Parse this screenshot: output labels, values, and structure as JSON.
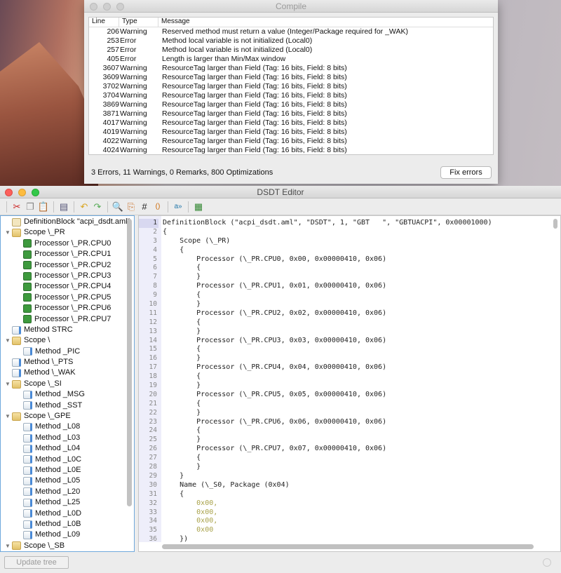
{
  "compile": {
    "title": "Compile",
    "columns": [
      "Line",
      "Type",
      "Message"
    ],
    "rows": [
      [
        "206",
        "Warning",
        "Reserved method must return a value (Integer/Package required for _WAK)"
      ],
      [
        "253",
        "Error",
        "Method local variable is not initialized (Local0)"
      ],
      [
        "257",
        "Error",
        "Method local variable is not initialized (Local0)"
      ],
      [
        "405",
        "Error",
        "Length is larger than Min/Max window"
      ],
      [
        "3607",
        "Warning",
        "ResourceTag larger than Field (Tag: 16 bits, Field: 8 bits)"
      ],
      [
        "3609",
        "Warning",
        "ResourceTag larger than Field (Tag: 16 bits, Field: 8 bits)"
      ],
      [
        "3702",
        "Warning",
        "ResourceTag larger than Field (Tag: 16 bits, Field: 8 bits)"
      ],
      [
        "3704",
        "Warning",
        "ResourceTag larger than Field (Tag: 16 bits, Field: 8 bits)"
      ],
      [
        "3869",
        "Warning",
        "ResourceTag larger than Field (Tag: 16 bits, Field: 8 bits)"
      ],
      [
        "3871",
        "Warning",
        "ResourceTag larger than Field (Tag: 16 bits, Field: 8 bits)"
      ],
      [
        "4017",
        "Warning",
        "ResourceTag larger than Field (Tag: 16 bits, Field: 8 bits)"
      ],
      [
        "4019",
        "Warning",
        "ResourceTag larger than Field (Tag: 16 bits, Field: 8 bits)"
      ],
      [
        "4022",
        "Warning",
        "ResourceTag larger than Field (Tag: 16 bits, Field: 8 bits)"
      ],
      [
        "4024",
        "Warning",
        "ResourceTag larger than Field (Tag: 16 bits, Field: 8 bits)"
      ]
    ],
    "status": "3 Errors, 11 Warnings, 0 Remarks, 800 Optimizations",
    "fix_label": "Fix errors"
  },
  "editor": {
    "title": "DSDT Editor",
    "toolbar": [
      "cut-icon",
      "copy-icon",
      "paste-icon",
      "compile-icon",
      "undo-icon",
      "redo-icon",
      "find-icon",
      "replace-icon",
      "hash-icon",
      "brace-match-icon",
      "text-icon",
      "patch-icon"
    ],
    "tree": [
      {
        "l": 0,
        "i": "def",
        "t": "DefinitionBlock \"acpi_dsdt.aml\""
      },
      {
        "l": 0,
        "i": "folder",
        "t": "Scope \\_PR",
        "x": true
      },
      {
        "l": 1,
        "i": "cpu",
        "t": "Processor \\_PR.CPU0"
      },
      {
        "l": 1,
        "i": "cpu",
        "t": "Processor \\_PR.CPU1"
      },
      {
        "l": 1,
        "i": "cpu",
        "t": "Processor \\_PR.CPU2"
      },
      {
        "l": 1,
        "i": "cpu",
        "t": "Processor \\_PR.CPU3"
      },
      {
        "l": 1,
        "i": "cpu",
        "t": "Processor \\_PR.CPU4"
      },
      {
        "l": 1,
        "i": "cpu",
        "t": "Processor \\_PR.CPU5"
      },
      {
        "l": 1,
        "i": "cpu",
        "t": "Processor \\_PR.CPU6"
      },
      {
        "l": 1,
        "i": "cpu",
        "t": "Processor \\_PR.CPU7"
      },
      {
        "l": 0,
        "i": "method",
        "t": "Method STRC"
      },
      {
        "l": 0,
        "i": "folder",
        "t": "Scope \\",
        "x": true
      },
      {
        "l": 1,
        "i": "method",
        "t": "Method _PIC"
      },
      {
        "l": 0,
        "i": "method",
        "t": "Method \\_PTS"
      },
      {
        "l": 0,
        "i": "method",
        "t": "Method \\_WAK"
      },
      {
        "l": 0,
        "i": "folder",
        "t": "Scope \\_SI",
        "x": true
      },
      {
        "l": 1,
        "i": "method",
        "t": "Method _MSG"
      },
      {
        "l": 1,
        "i": "method",
        "t": "Method _SST"
      },
      {
        "l": 0,
        "i": "folder",
        "t": "Scope \\_GPE",
        "x": true
      },
      {
        "l": 1,
        "i": "method",
        "t": "Method _L08"
      },
      {
        "l": 1,
        "i": "method",
        "t": "Method _L03"
      },
      {
        "l": 1,
        "i": "method",
        "t": "Method _L04"
      },
      {
        "l": 1,
        "i": "method",
        "t": "Method _L0C"
      },
      {
        "l": 1,
        "i": "method",
        "t": "Method _L0E"
      },
      {
        "l": 1,
        "i": "method",
        "t": "Method _L05"
      },
      {
        "l": 1,
        "i": "method",
        "t": "Method _L20"
      },
      {
        "l": 1,
        "i": "method",
        "t": "Method _L25"
      },
      {
        "l": 1,
        "i": "method",
        "t": "Method _L0D"
      },
      {
        "l": 1,
        "i": "method",
        "t": "Method _L0B"
      },
      {
        "l": 1,
        "i": "method",
        "t": "Method _L09"
      },
      {
        "l": 0,
        "i": "folder",
        "t": "Scope \\_SB",
        "x": true
      }
    ],
    "code": [
      "DefinitionBlock (\"acpi_dsdt.aml\", \"DSDT\", 1, \"GBT   \", \"GBTUACPI\", 0x00001000)",
      "{",
      "    Scope (\\_PR)",
      "    {",
      "        Processor (\\_PR.CPU0, 0x00, 0x00000410, 0x06)",
      "        {",
      "        }",
      "        Processor (\\_PR.CPU1, 0x01, 0x00000410, 0x06)",
      "        {",
      "        }",
      "        Processor (\\_PR.CPU2, 0x02, 0x00000410, 0x06)",
      "        {",
      "        }",
      "        Processor (\\_PR.CPU3, 0x03, 0x00000410, 0x06)",
      "        {",
      "        }",
      "        Processor (\\_PR.CPU4, 0x04, 0x00000410, 0x06)",
      "        {",
      "        }",
      "        Processor (\\_PR.CPU5, 0x05, 0x00000410, 0x06)",
      "        {",
      "        }",
      "        Processor (\\_PR.CPU6, 0x06, 0x00000410, 0x06)",
      "        {",
      "        }",
      "        Processor (\\_PR.CPU7, 0x07, 0x00000410, 0x06)",
      "        {",
      "        }",
      "    }",
      "    Name (\\_S0, Package (0x04)",
      "    {",
      "        0x00,",
      "        0x00,",
      "        0x00,",
      "        0x00",
      "    })"
    ],
    "update_label": "Update tree",
    "colors": {
      "keyword": "#5a4fe0",
      "string": "#d08a35",
      "hex": "#a9a24a"
    }
  }
}
